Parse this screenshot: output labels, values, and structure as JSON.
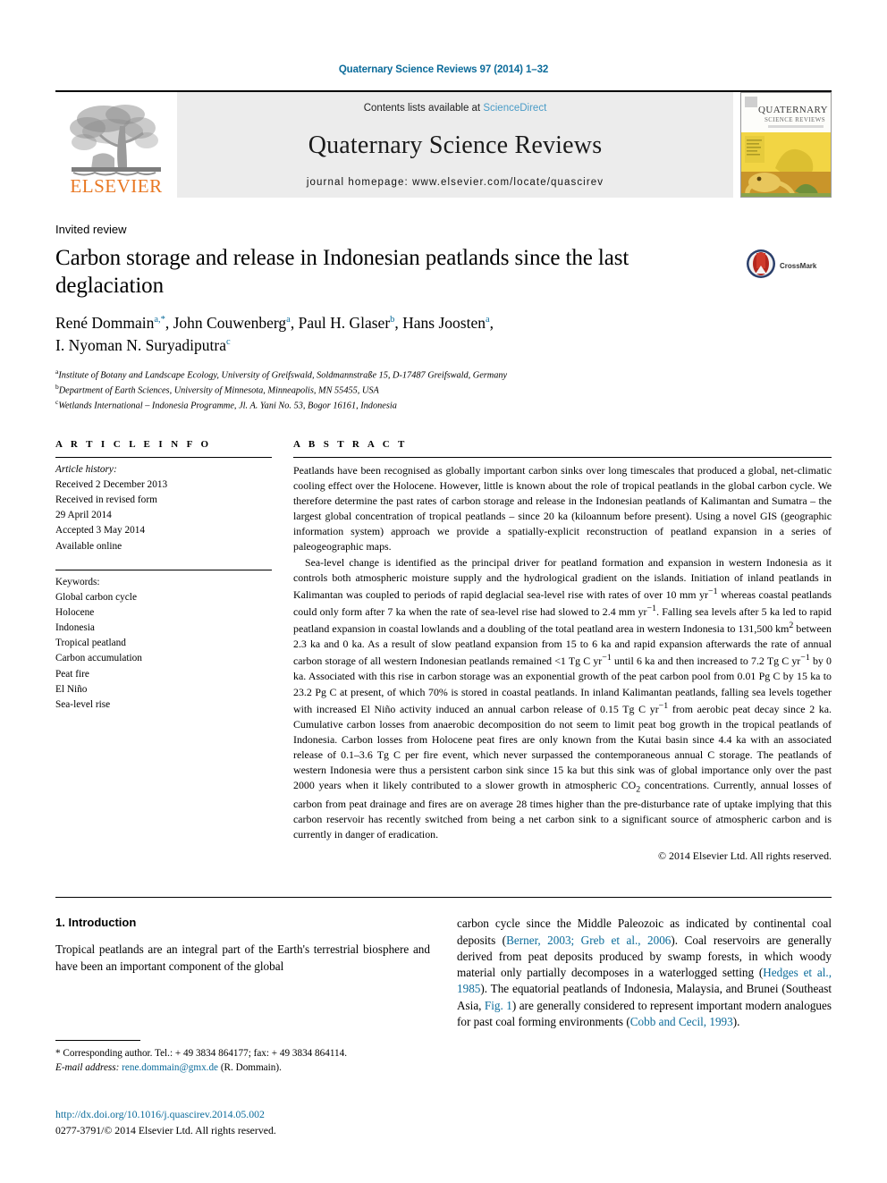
{
  "running_head": "Quaternary Science Reviews 97 (2014) 1–32",
  "masthead": {
    "contents_prefix": "Contents lists available at ",
    "sciencedirect": "ScienceDirect",
    "journal_title": "Quaternary Science Reviews",
    "homepage": "journal homepage: www.elsevier.com/locate/quascirev",
    "publisher_wordmark": "ELSEVIER",
    "publisher_logo_icon": "elsevier-tree-icon",
    "cover_title_line1": "QUATERNARY",
    "cover_title_line2": "SCIENCE REVIEWS",
    "accent_link_color": "#0b6b9a",
    "brand_orange": "#E87722",
    "band_gray": "#ececec"
  },
  "article": {
    "kind": "Invited review",
    "title": "Carbon storage and release in Indonesian peatlands since the last deglaciation",
    "crossmark_label": "CrossMark",
    "crossmark_icon": "crossmark-icon",
    "authors": [
      {
        "name": "René Dommain",
        "marks": "a,*"
      },
      {
        "name": "John Couwenberg",
        "marks": "a"
      },
      {
        "name": "Paul H. Glaser",
        "marks": "b"
      },
      {
        "name": "Hans Joosten",
        "marks": "a"
      },
      {
        "name": "I. Nyoman N. Suryadiputra",
        "marks": "c"
      }
    ],
    "affiliations": [
      {
        "mark": "a",
        "text": "Institute of Botany and Landscape Ecology, University of Greifswald, Soldmannstraße 15, D-17487 Greifswald, Germany"
      },
      {
        "mark": "b",
        "text": "Department of Earth Sciences, University of Minnesota, Minneapolis, MN 55455, USA"
      },
      {
        "mark": "c",
        "text": "Wetlands International – Indonesia Programme, Jl. A. Yani No. 53, Bogor 16161, Indonesia"
      }
    ]
  },
  "article_info": {
    "heading": "A R T I C L E  I N F O",
    "history_label": "Article history:",
    "history": [
      "Received 2 December 2013",
      "Received in revised form",
      "29 April 2014",
      "Accepted 3 May 2014",
      "Available online"
    ],
    "keywords_label": "Keywords:",
    "keywords": [
      "Global carbon cycle",
      "Holocene",
      "Indonesia",
      "Tropical peatland",
      "Carbon accumulation",
      "Peat fire",
      "El Niño",
      "Sea-level rise"
    ]
  },
  "abstract": {
    "heading": "A B S T R A C T",
    "paragraph1": "Peatlands have been recognised as globally important carbon sinks over long timescales that produced a global, net-climatic cooling effect over the Holocene. However, little is known about the role of tropical peatlands in the global carbon cycle. We therefore determine the past rates of carbon storage and release in the Indonesian peatlands of Kalimantan and Sumatra – the largest global concentration of tropical peatlands – since 20 ka (kiloannum before present). Using a novel GIS (geographic information system) approach we provide a spatially-explicit reconstruction of peatland expansion in a series of paleogeographic maps.",
    "paragraph2_html": "Sea-level change is identified as the principal driver for peatland formation and expansion in western Indonesia as it controls both atmospheric moisture supply and the hydrological gradient on the islands. Initiation of inland peatlands in Kalimantan was coupled to periods of rapid deglacial sea-level rise with rates of over 10 mm yr<sup>−1</sup> whereas coastal peatlands could only form after 7 ka when the rate of sea-level rise had slowed to 2.4 mm yr<sup>−1</sup>. Falling sea levels after 5 ka led to rapid peatland expansion in coastal lowlands and a doubling of the total peatland area in western Indonesia to 131,500 km<sup>2</sup> between 2.3 ka and 0 ka. As a result of slow peatland expansion from 15 to 6 ka and rapid expansion afterwards the rate of annual carbon storage of all western Indonesian peatlands remained &lt;1 Tg C yr<sup>−1</sup> until 6 ka and then increased to 7.2 Tg C yr<sup>−1</sup> by 0 ka. Associated with this rise in carbon storage was an exponential growth of the peat carbon pool from 0.01 Pg C by 15 ka to 23.2 Pg C at present, of which 70% is stored in coastal peatlands. In inland Kalimantan peatlands, falling sea levels together with increased El Niño activity induced an annual carbon release of 0.15 Tg C yr<sup>−1</sup> from aerobic peat decay since 2 ka. Cumulative carbon losses from anaerobic decomposition do not seem to limit peat bog growth in the tropical peatlands of Indonesia. Carbon losses from Holocene peat fires are only known from the Kutai basin since 4.4 ka with an associated release of 0.1–3.6 Tg C per fire event, which never surpassed the contemporaneous annual C storage. The peatlands of western Indonesia were thus a persistent carbon sink since 15 ka but this sink was of global importance only over the past 2000 years when it likely contributed to a slower growth in atmospheric CO<sub>2</sub> concentrations. Currently, annual losses of carbon from peat drainage and fires are on average 28 times higher than the pre-disturbance rate of uptake implying that this carbon reservoir has recently switched from being a net carbon sink to a significant source of atmospheric carbon and is currently in danger of eradication.",
    "copyright": "© 2014 Elsevier Ltd. All rights reserved."
  },
  "introduction": {
    "section_number_title": "1. Introduction",
    "left_paragraph": "Tropical peatlands are an integral part of the Earth's terrestrial biosphere and have been an important component of the global",
    "right_paragraph_html": "carbon cycle since the Middle Paleozoic as indicated by continental coal deposits (<span class=\"link\">Berner, 2003; Greb et al., 2006</span>). Coal reservoirs are generally derived from peat deposits produced by swamp forests, in which woody material only partially decomposes in a waterlogged setting (<span class=\"link\">Hedges et al., 1985</span>). The equatorial peatlands of Indonesia, Malaysia, and Brunei (Southeast Asia, <span class=\"link\">Fig. 1</span>) are generally considered to represent important modern analogues for past coal forming environments (<span class=\"link\">Cobb and Cecil, 1993</span>)."
  },
  "footnote": {
    "corresponding_html": "* Corresponding author. Tel.: + 49 3834 864177; fax: + 49 3834 864114.",
    "email_label": "E-mail address:",
    "email": "rene.dommain@gmx.de",
    "email_owner": "(R. Dommain)."
  },
  "footer": {
    "doi": "http://dx.doi.org/10.1016/j.quascirev.2014.05.002",
    "issn_line": "0277-3791/© 2014 Elsevier Ltd. All rights reserved."
  }
}
